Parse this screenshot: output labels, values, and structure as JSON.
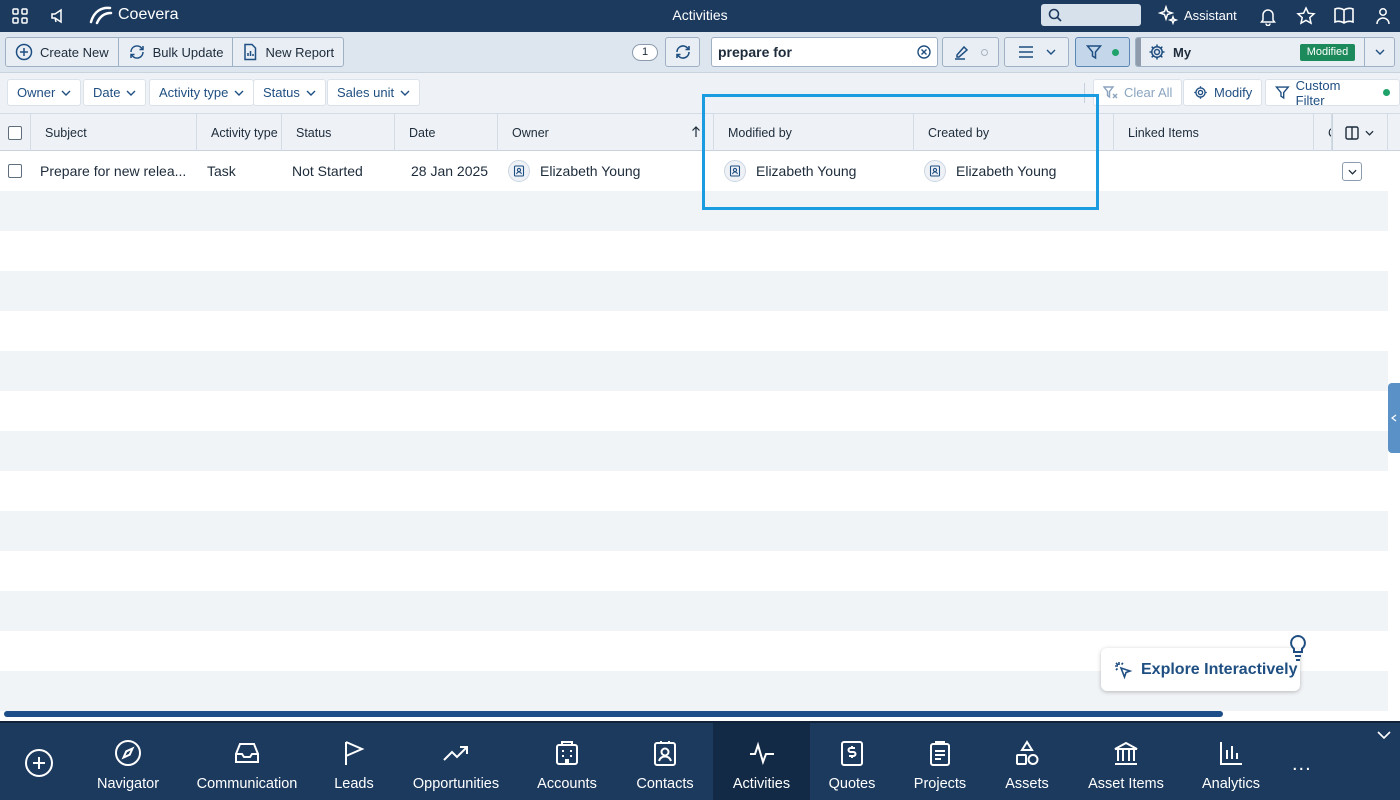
{
  "topbar": {
    "brand": "Coevera",
    "title": "Activities",
    "assistant": "Assistant"
  },
  "toolbar": {
    "create_new": "Create New",
    "bulk_update": "Bulk Update",
    "new_report": "New Report",
    "count": "1",
    "search_value": "prepare for",
    "view_name": "My",
    "view_badge": "Modified"
  },
  "filters": {
    "chips": [
      "Owner",
      "Date",
      "Activity type",
      "Status",
      "Sales unit"
    ],
    "clear_all": "Clear All",
    "modify": "Modify",
    "custom_filter": "Custom Filter"
  },
  "table": {
    "columns": [
      "Subject",
      "Activity type",
      "Status",
      "Date",
      "Owner",
      "Modified by",
      "Created by",
      "Linked Items",
      "C"
    ],
    "rows": [
      {
        "subject": "Prepare for new relea...",
        "activity_type": "Task",
        "status": "Not Started",
        "date": "28 Jan 2025",
        "owner": "Elizabeth Young",
        "modified_by": "Elizabeth Young",
        "created_by": "Elizabeth Young",
        "linked_items": ""
      }
    ]
  },
  "explore": {
    "label": "Explore Interactively"
  },
  "bottomnav": {
    "items": [
      "Navigator",
      "Communication",
      "Leads",
      "Opportunities",
      "Accounts",
      "Contacts",
      "Activities",
      "Quotes",
      "Projects",
      "Assets",
      "Asset Items",
      "Analytics"
    ],
    "active": "Activities",
    "more": "..."
  },
  "colors": {
    "header_bg": "#1c3a5e",
    "accent_green": "#1d8a5b",
    "highlight": "#1b9ce0"
  }
}
